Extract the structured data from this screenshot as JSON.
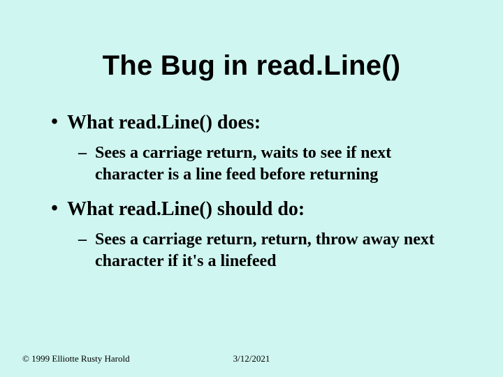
{
  "title": "The Bug in read.Line()",
  "bullets": [
    {
      "level": 1,
      "text": "What read.Line() does:"
    },
    {
      "level": 2,
      "text": "Sees a carriage return, waits to see if next character is a line feed before returning"
    },
    {
      "level": 1,
      "text": "What read.Line() should do:"
    },
    {
      "level": 2,
      "text": "Sees a carriage return, return, throw away next character if it's a linefeed"
    }
  ],
  "footer": {
    "copyright": "© 1999 Elliotte Rusty Harold",
    "date": "3/12/2021"
  }
}
